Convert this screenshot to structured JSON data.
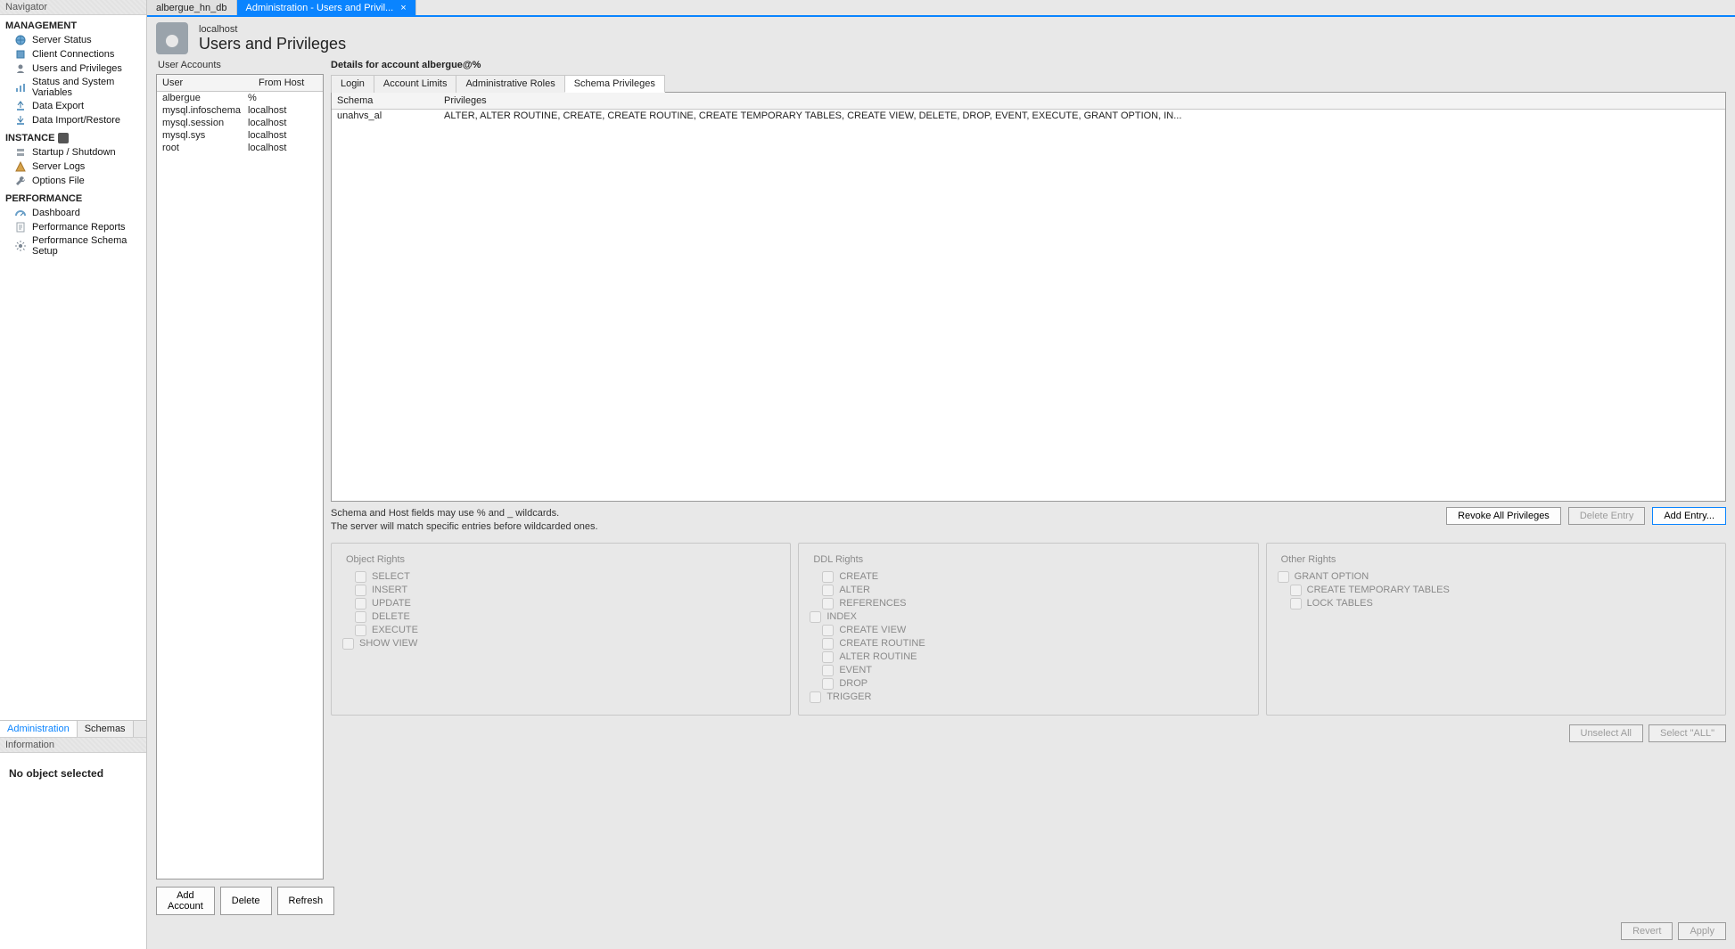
{
  "navigator": {
    "title": "Navigator",
    "sections": [
      {
        "header": "MANAGEMENT",
        "has_icon": false,
        "items": [
          {
            "id": "server-status",
            "label": "Server Status"
          },
          {
            "id": "client-connections",
            "label": "Client Connections"
          },
          {
            "id": "users-privileges",
            "label": "Users and Privileges"
          },
          {
            "id": "status-variables",
            "label": "Status and System Variables"
          },
          {
            "id": "data-export",
            "label": "Data Export"
          },
          {
            "id": "data-import",
            "label": "Data Import/Restore"
          }
        ]
      },
      {
        "header": "INSTANCE",
        "has_icon": true,
        "items": [
          {
            "id": "startup-shutdown",
            "label": "Startup / Shutdown"
          },
          {
            "id": "server-logs",
            "label": "Server Logs"
          },
          {
            "id": "options-file",
            "label": "Options File"
          }
        ]
      },
      {
        "header": "PERFORMANCE",
        "has_icon": false,
        "items": [
          {
            "id": "dashboard",
            "label": "Dashboard"
          },
          {
            "id": "perf-reports",
            "label": "Performance Reports"
          },
          {
            "id": "perf-schema-setup",
            "label": "Performance Schema Setup"
          }
        ]
      }
    ],
    "bottom_tabs": {
      "admin": "Administration",
      "schemas": "Schemas"
    },
    "info_title": "Information",
    "no_object": "No object selected"
  },
  "top_tabs": [
    {
      "id": "db",
      "label": "albergue_hn_db",
      "active": false,
      "closable": false
    },
    {
      "id": "admin",
      "label": "Administration - Users and Privil...",
      "active": true,
      "closable": true
    }
  ],
  "header": {
    "host": "localhost",
    "title": "Users and Privileges"
  },
  "user_accounts": {
    "caption": "User Accounts",
    "columns": {
      "user": "User",
      "host": "From Host"
    },
    "rows": [
      {
        "user": "albergue",
        "host": "%"
      },
      {
        "user": "mysql.infoschema",
        "host": "localhost"
      },
      {
        "user": "mysql.session",
        "host": "localhost"
      },
      {
        "user": "mysql.sys",
        "host": "localhost"
      },
      {
        "user": "root",
        "host": "localhost"
      }
    ],
    "buttons": {
      "add": "Add Account",
      "delete": "Delete",
      "refresh": "Refresh"
    }
  },
  "details": {
    "caption": "Details for account albergue@%",
    "tabs": {
      "login": "Login",
      "limits": "Account Limits",
      "roles": "Administrative Roles",
      "schema": "Schema Privileges"
    },
    "active_tab": "schema",
    "priv_table": {
      "columns": {
        "schema": "Schema",
        "privileges": "Privileges"
      },
      "rows": [
        {
          "schema": "unahvs_al",
          "privileges": "ALTER, ALTER ROUTINE, CREATE, CREATE ROUTINE, CREATE TEMPORARY TABLES, CREATE VIEW, DELETE, DROP, EVENT, EXECUTE, GRANT OPTION, IN..."
        }
      ]
    },
    "hints_line1": "Schema and Host fields may use % and _ wildcards.",
    "hints_line2": "The server will match specific entries before wildcarded ones.",
    "priv_buttons": {
      "revoke": "Revoke All Privileges",
      "delete": "Delete Entry",
      "add": "Add Entry..."
    },
    "rights_groups": {
      "object": {
        "title": "Object Rights",
        "items": [
          "SELECT",
          "INSERT",
          "UPDATE",
          "DELETE",
          "EXECUTE"
        ],
        "last": "SHOW VIEW"
      },
      "ddl": {
        "title": "DDL Rights",
        "top": [
          "CREATE",
          "ALTER",
          "REFERENCES"
        ],
        "index": "INDEX",
        "indented": [
          "CREATE VIEW",
          "CREATE ROUTINE",
          "ALTER ROUTINE",
          "EVENT",
          "DROP"
        ],
        "last": "TRIGGER"
      },
      "other": {
        "title": "Other Rights",
        "items": [
          "GRANT OPTION",
          "CREATE TEMPORARY TABLES",
          "LOCK TABLES"
        ]
      }
    },
    "sel_buttons": {
      "unselect": "Unselect All",
      "selectall": "Select \"ALL\""
    },
    "footer_buttons": {
      "revert": "Revert",
      "apply": "Apply"
    }
  },
  "icons": {
    "server-status": "globe",
    "client-connections": "plug",
    "users-privileges": "user",
    "status-variables": "bars",
    "data-export": "export",
    "data-import": "import",
    "startup-shutdown": "server",
    "server-logs": "warn",
    "options-file": "wrench",
    "dashboard": "gauge",
    "perf-reports": "report",
    "perf-schema-setup": "gear"
  }
}
